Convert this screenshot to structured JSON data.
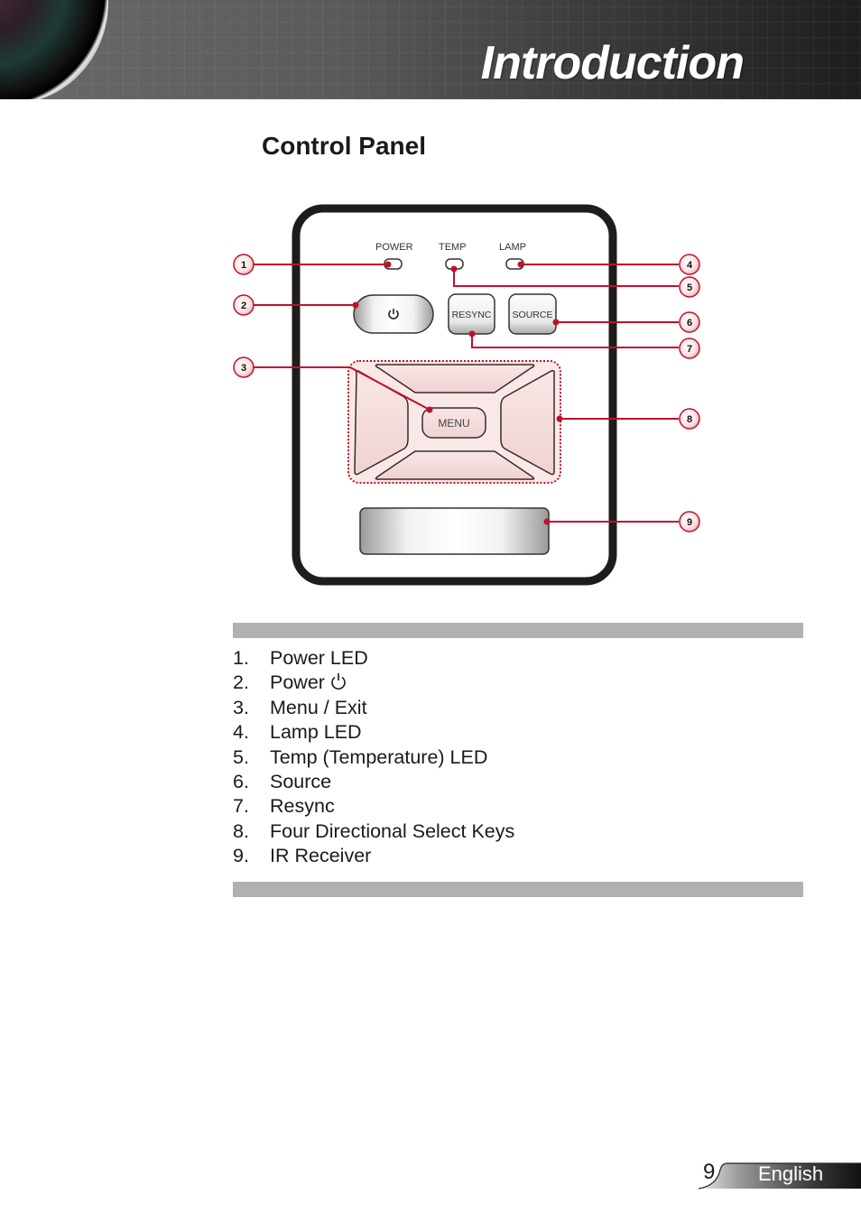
{
  "header": {
    "title": "Introduction",
    "image": "camera-lens-icon"
  },
  "section": {
    "title": "Control Panel"
  },
  "diagram": {
    "led_labels": [
      "POWER",
      "TEMP",
      "LAMP"
    ],
    "buttons": {
      "power_icon": "power-icon",
      "resync": "RESYNC",
      "source": "SOURCE",
      "menu": "MENU"
    },
    "callouts": [
      "1",
      "2",
      "3",
      "4",
      "5",
      "6",
      "7",
      "8",
      "9"
    ],
    "accent_color": "#c0102c"
  },
  "legend": {
    "items": [
      {
        "num": "1.",
        "label": "Power LED"
      },
      {
        "num": "2.",
        "label": "Power",
        "icon": "power-icon"
      },
      {
        "num": "3.",
        "label": "Menu / Exit"
      },
      {
        "num": "4.",
        "label": "Lamp LED"
      },
      {
        "num": "5.",
        "label": "Temp (Temperature) LED"
      },
      {
        "num": "6.",
        "label": "Source"
      },
      {
        "num": "7.",
        "label": "Resync"
      },
      {
        "num": "8.",
        "label": "Four Directional Select Keys"
      },
      {
        "num": "9.",
        "label": "IR Receiver"
      }
    ]
  },
  "footer": {
    "page_number": "9",
    "language": "English"
  }
}
